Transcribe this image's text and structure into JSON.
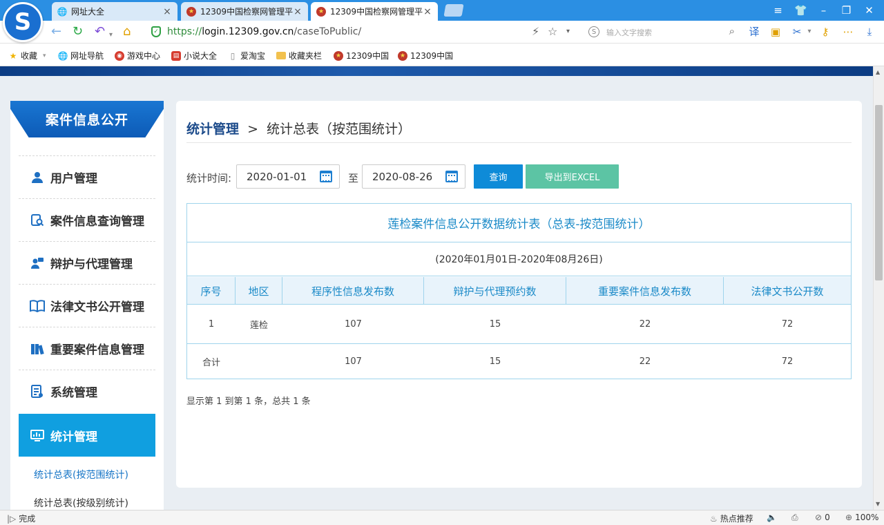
{
  "browser": {
    "tabs": [
      {
        "label": "网址大全",
        "icon": "globe-icon"
      },
      {
        "label": "12309中国检察网管理平",
        "icon": "emblem-icon"
      },
      {
        "label": "12309中国检察网管理平",
        "icon": "emblem-icon",
        "active": true
      }
    ],
    "url_scheme": "https://",
    "url_host": "login.12309.gov.cn",
    "url_path": "/caseToPublic/",
    "search_placeholder": "输入文字搜索",
    "bookmarks": [
      "收藏",
      "网址导航",
      "游戏中心",
      "小说大全",
      "爱淘宝",
      "收藏夹栏",
      "12309中国",
      "12309中国"
    ]
  },
  "sidebar": {
    "title": "案件信息公开",
    "items": [
      {
        "label": "用户管理"
      },
      {
        "label": "案件信息查询管理"
      },
      {
        "label": "辩护与代理管理"
      },
      {
        "label": "法律文书公开管理"
      },
      {
        "label": "重要案件信息管理"
      },
      {
        "label": "系统管理"
      },
      {
        "label": "统计管理",
        "active": true
      }
    ],
    "subitems": [
      {
        "label": "统计总表(按范围统计)",
        "active": true
      },
      {
        "label": "统计总表(按级别统计)"
      }
    ]
  },
  "main": {
    "breadcrumb_root": "统计管理",
    "breadcrumb_sep": ">",
    "breadcrumb_current": "统计总表（按范围统计）",
    "filter": {
      "label": "统计时间:",
      "start_date": "2020-01-01",
      "to_label": "至",
      "end_date": "2020-08-26",
      "query_button": "查询",
      "export_button": "导出到EXCEL"
    },
    "table": {
      "title": "莲检案件信息公开数据统计表（总表-按范围统计）",
      "range": "(2020年01月01日-2020年08月26日)",
      "columns": [
        "序号",
        "地区",
        "程序性信息发布数",
        "辩护与代理预约数",
        "重要案件信息发布数",
        "法律文书公开数"
      ],
      "rows": [
        [
          "1",
          "莲检",
          "107",
          "15",
          "22",
          "72"
        ]
      ],
      "total": [
        "合计",
        "",
        "107",
        "15",
        "22",
        "72"
      ]
    },
    "pager_text": "显示第 1 到第 1 条，总共 1 条"
  },
  "status": {
    "left": "完成",
    "hot": "热点推荐",
    "count": "0",
    "zoom": "100%"
  }
}
